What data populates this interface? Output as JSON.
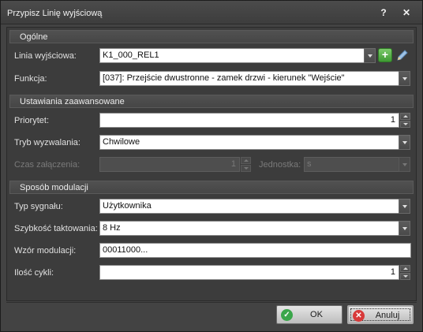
{
  "window": {
    "title": "Przypisz Linię wyjściową",
    "help_glyph": "?",
    "close_glyph": "✕"
  },
  "sections": {
    "general": "Ogólne",
    "advanced": "Ustawiania zaawansowane",
    "modulation": "Sposób modulacji"
  },
  "general": {
    "output_line_label": "Linia wyjściowa:",
    "output_line_value": "K1_000_REL1",
    "function_label": "Funkcja:",
    "function_value": "[037]: Przejście dwustronne - zamek drzwi - kierunek \"Wejście\""
  },
  "advanced": {
    "priority_label": "Priorytet:",
    "priority_value": "1",
    "trigger_mode_label": "Tryb wyzwalania:",
    "trigger_mode_value": "Chwilowe",
    "on_time_label": "Czas załączenia:",
    "on_time_value": "1",
    "unit_label": "Jednostka:",
    "unit_value": "s"
  },
  "modulation": {
    "signal_type_label": "Typ sygnału:",
    "signal_type_value": "Użytkownika",
    "clock_speed_label": "Szybkość taktowania:",
    "clock_speed_value": "8 Hz",
    "pattern_label": "Wzór modulacji:",
    "pattern_value": "00011000...",
    "cycles_label": "Ilość cykli:",
    "cycles_value": "1"
  },
  "buttons": {
    "ok_label": "OK",
    "cancel_label": "Anuluj"
  },
  "icons": {
    "add": "plus-icon",
    "edit": "pencil-icon",
    "ok": "check-icon",
    "cancel": "x-icon"
  },
  "colors": {
    "ok_icon": "#3aa64a",
    "cancel_icon": "#d83a3a",
    "add_button": "#4aa83d"
  }
}
